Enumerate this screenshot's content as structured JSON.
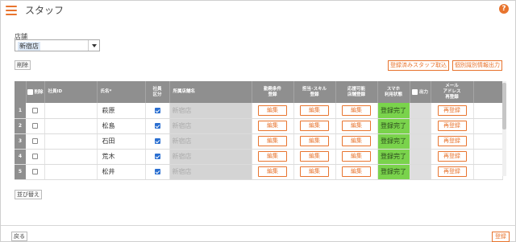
{
  "header": {
    "title": "スタッフ"
  },
  "store": {
    "label": "店舗",
    "selected": "新宿店"
  },
  "actions": {
    "delete_label": "削除",
    "import_label": "登録済みスタッフ取込",
    "output_label": "個別識別情報出力",
    "sort_label": "並び替え",
    "back_label": "戻る",
    "register_label": "登録"
  },
  "table": {
    "headers": {
      "delete": "削除",
      "employee_id": "社員ID",
      "name": "氏名*",
      "employee_class": [
        "社員",
        "区分"
      ],
      "store": "所属店舗名",
      "work_conditions": [
        "勤務条件",
        "登録"
      ],
      "skills": [
        "担当･スキル",
        "登録"
      ],
      "available_stores": [
        "応援可能",
        "店舗登録"
      ],
      "phone_status": [
        "スマホ",
        "利用状態"
      ],
      "output": "出力",
      "email": [
        "メール",
        "アドレス",
        "再登録"
      ]
    },
    "rows": [
      {
        "num": "1",
        "name": "萩原",
        "store": "新宿店",
        "edit": "編集",
        "status": "登録完了",
        "reregister": "再登録",
        "employee_checked": true
      },
      {
        "num": "2",
        "name": "松島",
        "store": "新宿店",
        "edit": "編集",
        "status": "登録完了",
        "reregister": "再登録",
        "employee_checked": true
      },
      {
        "num": "3",
        "name": "石田",
        "store": "新宿店",
        "edit": "編集",
        "status": "登録完了",
        "reregister": "再登録",
        "employee_checked": true
      },
      {
        "num": "4",
        "name": "荒木",
        "store": "新宿店",
        "edit": "編集",
        "status": "登録完了",
        "reregister": "再登録",
        "employee_checked": true
      },
      {
        "num": "5",
        "name": "松井",
        "store": "新宿店",
        "edit": "編集",
        "status": "登録完了",
        "reregister": "再登録",
        "employee_checked": true
      }
    ]
  },
  "colors": {
    "accent": "#e8742e",
    "status_green": "#7ad34c",
    "header_gray": "#8f8f8f"
  }
}
